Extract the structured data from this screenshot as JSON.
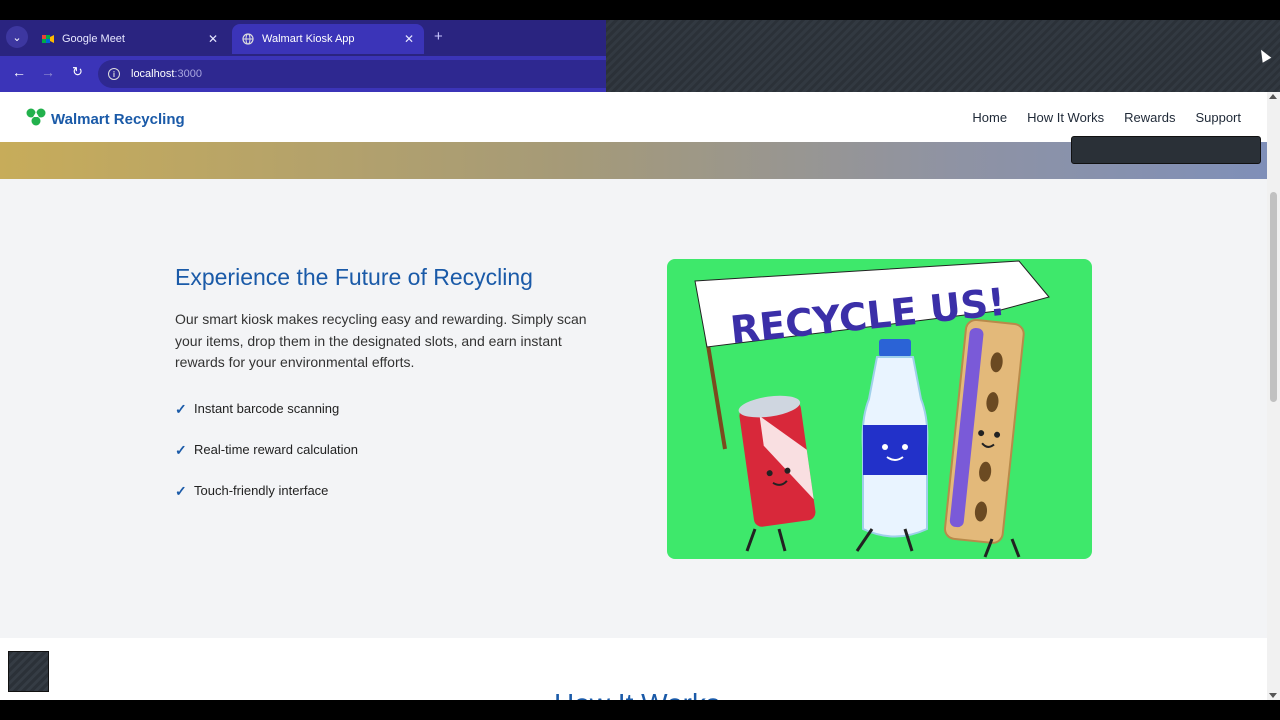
{
  "browser": {
    "tabs": [
      {
        "title": "Google Meet",
        "icon": "google-meet-icon",
        "active": false
      },
      {
        "title": "Walmart Kiosk App",
        "icon": "globe-icon",
        "active": true
      }
    ],
    "url": "localhost",
    "url_port": ":3000"
  },
  "site": {
    "brand": "Walmart Recycling",
    "nav": [
      "Home",
      "How It Works",
      "Rewards",
      "Support"
    ]
  },
  "hero": {
    "title": "Experience the Future of Recycling",
    "description": "Our smart kiosk makes recycling easy and rewarding. Simply scan your items, drop them in the designated slots, and earn instant rewards for your environmental efforts.",
    "features": [
      "Instant barcode scanning",
      "Real-time reward calculation",
      "Touch-friendly interface"
    ],
    "check_glyph": "✓",
    "banner_text": "RECYCLE US!"
  },
  "next_section": {
    "title": "How It Works"
  },
  "colors": {
    "brand_blue": "#1a5aa8",
    "illustration_bg": "#3ee86b",
    "chrome": "#3b34b8"
  }
}
